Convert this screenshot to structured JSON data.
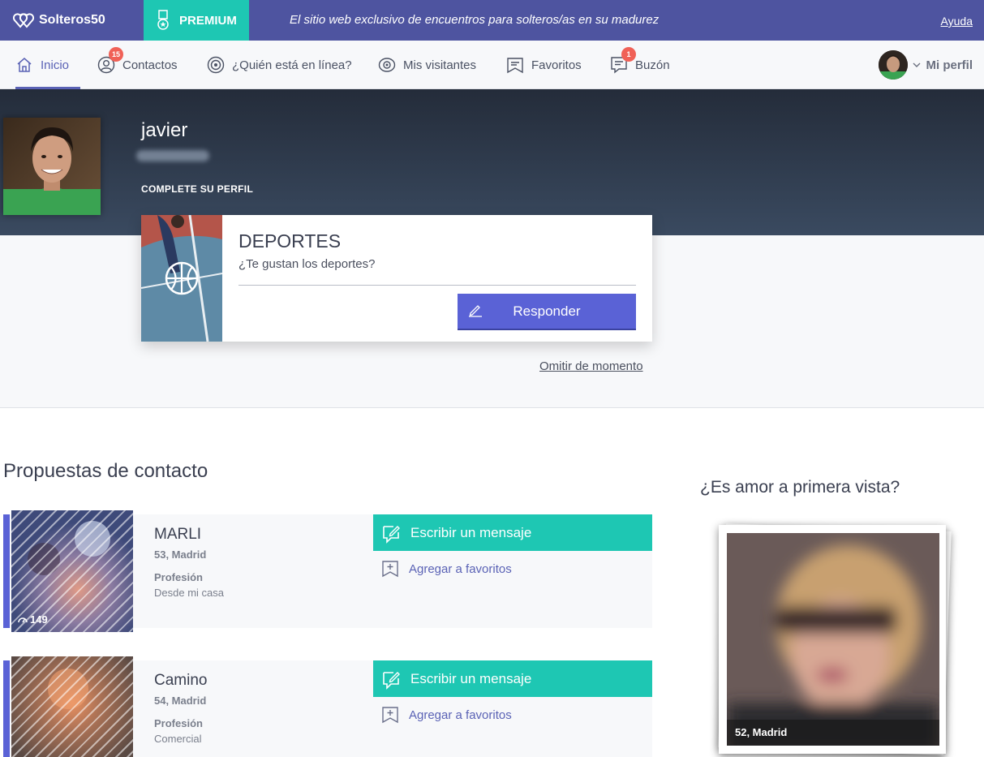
{
  "topbar": {
    "logo_text": "Solteros50",
    "premium_label": "PREMIUM",
    "tagline": "El sitio web exclusivo de encuentros para solteros/as en su madurez",
    "help_link": "Ayuda"
  },
  "nav": {
    "items": [
      {
        "label": "Inicio",
        "icon": "home-icon",
        "active": true
      },
      {
        "label": "Contactos",
        "icon": "user-circle-icon",
        "badge": "15"
      },
      {
        "label": "¿Quién está en línea?",
        "icon": "target-icon"
      },
      {
        "label": "Mis visitantes",
        "icon": "eye-icon"
      },
      {
        "label": "Favoritos",
        "icon": "bookmark-icon"
      },
      {
        "label": "Buzón",
        "icon": "message-icon",
        "badge": "1"
      }
    ],
    "profile_label": "Mi perfil"
  },
  "hero": {
    "name": "javier",
    "complete_label": "COMPLETE SU PERFIL"
  },
  "question": {
    "title": "DEPORTES",
    "subtitle": "¿Te gustan los deportes?",
    "answer_button": "Responder",
    "skip_link": "Omitir de momento"
  },
  "proposals": {
    "title": "Propuestas de contacto",
    "items": [
      {
        "name": "MARLI",
        "age_city": "53, Madrid",
        "profession_label": "Profesión",
        "profession": "Desde mi casa",
        "views": "149",
        "message_button": "Escribir un mensaje",
        "favorite_link": "Agregar a favoritos"
      },
      {
        "name": "Camino",
        "age_city": "54, Madrid",
        "profession_label": "Profesión",
        "profession": "Comercial",
        "message_button": "Escribir un mensaje",
        "favorite_link": "Agregar a favoritos"
      }
    ]
  },
  "love": {
    "title": "¿Es amor a primera vista?",
    "caption": "52, Madrid"
  },
  "colors": {
    "topbar": "#4e54a0",
    "premium": "#1ec7b3",
    "accent": "#5a62d6",
    "badge": "#f06157"
  }
}
